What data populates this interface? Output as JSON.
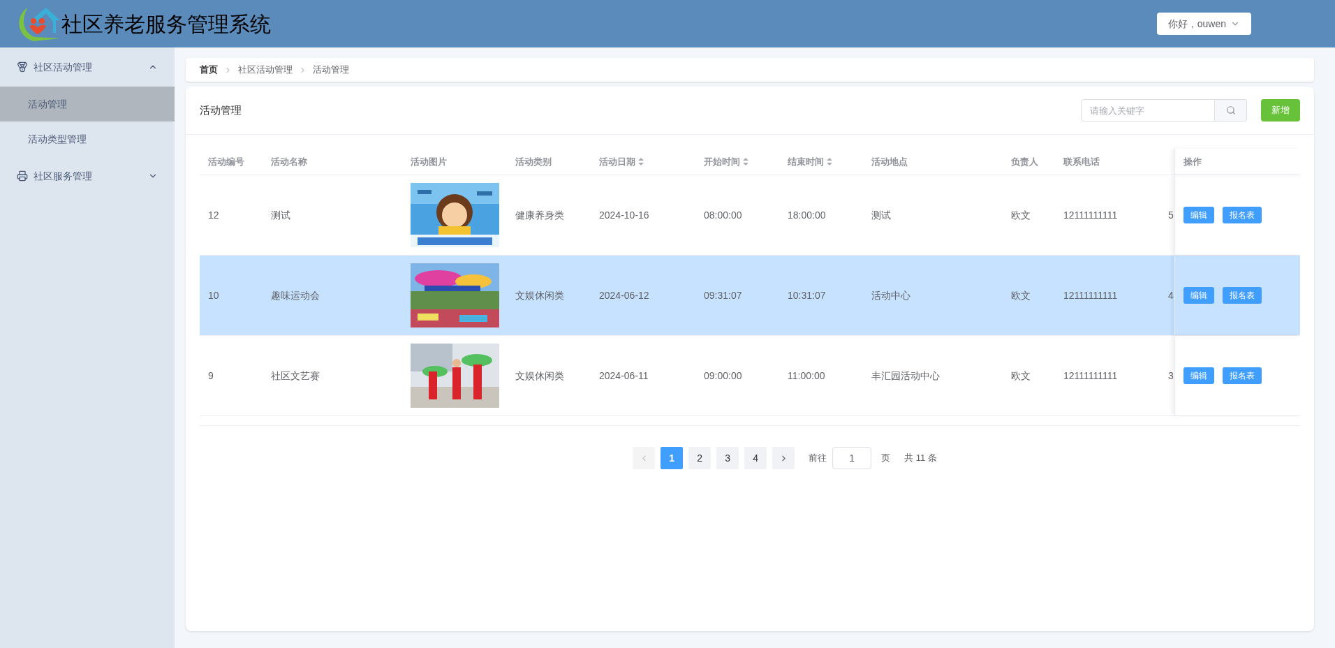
{
  "header": {
    "title": "社区养老服务管理系统",
    "user_menu": "你好，ouwen"
  },
  "sidebar": {
    "groups": [
      {
        "label": "社区活动管理",
        "expanded": true,
        "children": [
          {
            "label": "活动管理",
            "selected": true
          },
          {
            "label": "活动类型管理",
            "selected": false
          }
        ]
      },
      {
        "label": "社区服务管理",
        "expanded": false
      }
    ]
  },
  "breadcrumb": [
    "首页",
    "社区活动管理",
    "活动管理"
  ],
  "panel": {
    "title": "活动管理",
    "search": {
      "placeholder": "请输入关键字"
    },
    "add_button": "新增"
  },
  "table": {
    "columns": [
      {
        "label": "活动编号",
        "sortable": false
      },
      {
        "label": "活动名称",
        "sortable": false
      },
      {
        "label": "活动图片",
        "sortable": false
      },
      {
        "label": "活动类别",
        "sortable": false
      },
      {
        "label": "活动日期",
        "sortable": true
      },
      {
        "label": "开始时间",
        "sortable": true
      },
      {
        "label": "结束时间",
        "sortable": true
      },
      {
        "label": "活动地点",
        "sortable": false
      },
      {
        "label": "负责人",
        "sortable": false
      },
      {
        "label": "联系电话",
        "sortable": false
      }
    ],
    "action_column": "操作",
    "rows": [
      {
        "id": "12",
        "name": "测试",
        "category": "健康养身类",
        "date": "2024-10-16",
        "start": "08:00:00",
        "end": "18:00:00",
        "location": "测试",
        "owner": "欧文",
        "phone": "12111111111",
        "column_11": "5",
        "selected": false,
        "actions": [
          "编辑",
          "报名表"
        ]
      },
      {
        "id": "10",
        "name": "趣味运动会",
        "category": "文娱休闲类",
        "date": "2024-06-12",
        "start": "09:31:07",
        "end": "10:31:07",
        "location": "活动中心",
        "owner": "欧文",
        "phone": "12111111111",
        "column_11": "4",
        "selected": true,
        "actions": [
          "编辑",
          "报名表"
        ]
      },
      {
        "id": "9",
        "name": "社区文艺赛",
        "category": "文娱休闲类",
        "date": "2024-06-11",
        "start": "09:00:00",
        "end": "11:00:00",
        "location": "丰汇园活动中心",
        "owner": "欧文",
        "phone": "12111111111",
        "column_11": "3",
        "selected": false,
        "actions": [
          "编辑",
          "报名表"
        ]
      }
    ]
  },
  "pagination": {
    "pages": [
      {
        "label": "1",
        "selected": true
      },
      {
        "label": "2",
        "selected": false
      },
      {
        "label": "3",
        "selected": false
      },
      {
        "label": "4",
        "selected": false
      }
    ],
    "goto_label": "前往",
    "goto_value": "1",
    "page_suffix": "页",
    "total": "共 11 条"
  }
}
